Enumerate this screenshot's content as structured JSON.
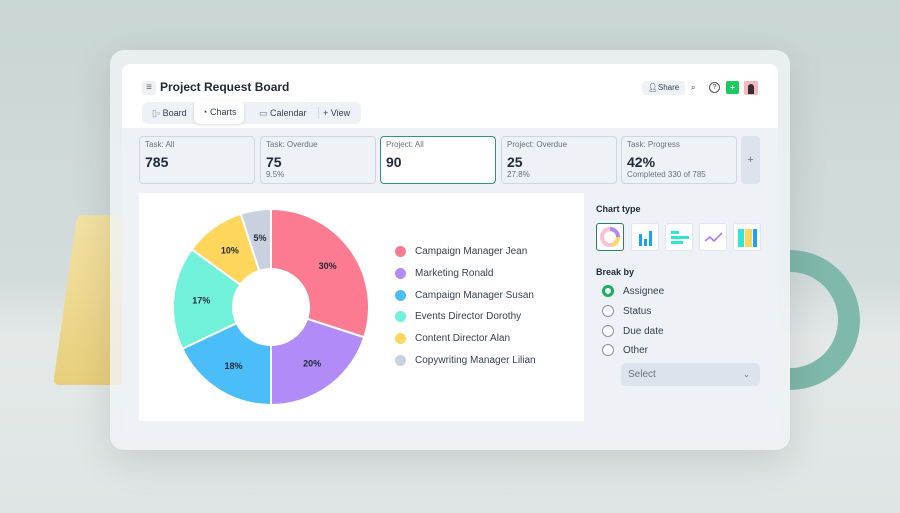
{
  "header": {
    "title": "Project Request Board",
    "share": "Share"
  },
  "tabs": [
    {
      "label": "Board"
    },
    {
      "label": "Charts"
    },
    {
      "label": "Calendar"
    },
    {
      "label": "View"
    }
  ],
  "stats": [
    {
      "label": "Task: All",
      "value": "785",
      "sub": ""
    },
    {
      "label": "Task: Overdue",
      "value": "75",
      "sub": "9.5%"
    },
    {
      "label": "Project: All",
      "value": "90",
      "sub": ""
    },
    {
      "label": "Project: Overdue",
      "value": "25",
      "sub": "27.8%"
    },
    {
      "label": "Task: Progress",
      "value": "42%",
      "sub": "Completed 330 of 785"
    }
  ],
  "add_stat": "+",
  "chart_data": {
    "type": "pie",
    "donut": true,
    "categories": [
      "Campaign Manager Jean",
      "Marketing Ronald",
      "Campaign Manager Susan",
      "Events Director Dorothy",
      "Content Director Alan",
      "Copywriting Manager Lilian"
    ],
    "values": [
      30,
      20,
      18,
      17,
      10,
      5
    ],
    "labels": [
      "30%",
      "20%",
      "18%",
      "17%",
      "10%",
      "5%"
    ],
    "colors": [
      "#fd7b91",
      "#b18cf8",
      "#4bbdf9",
      "#71f0da",
      "#fdd65b",
      "#c9d1de"
    ],
    "legend": "right"
  },
  "side": {
    "chart_type": "Chart type",
    "break_by": "Break by",
    "options": [
      "Assignee",
      "Status",
      "Due date",
      "Other"
    ],
    "selected": "Assignee",
    "select": "Select"
  }
}
